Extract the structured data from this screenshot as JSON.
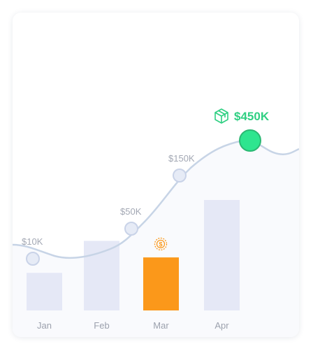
{
  "chart_data": {
    "type": "bar",
    "categories": [
      "Jan",
      "Feb",
      "Mar",
      "Apr"
    ],
    "bar_heights_relative": [
      0.34,
      0.63,
      0.48,
      1.0
    ],
    "highlight_category": "Mar",
    "line_points": [
      {
        "label": "$10K",
        "value": 10
      },
      {
        "label": "$50K",
        "value": 50
      },
      {
        "label": "$150K",
        "value": 150
      },
      {
        "label": "$450K",
        "value": 450
      }
    ],
    "peak_label": "$450K",
    "colors": {
      "bar": "#e5e8f6",
      "bar_highlight": "#fb981a",
      "line": "#c7d4e6",
      "point_fill": "#e6ebf6",
      "point_stroke": "#c9d3e8",
      "peak_fill": "#2ee58f",
      "peak_stroke": "#2bb873",
      "peak_text": "#2fcf82",
      "coin": "#fb981a"
    },
    "icons": {
      "peak": "cube-icon",
      "highlight": "dollar-coin-icon"
    }
  }
}
